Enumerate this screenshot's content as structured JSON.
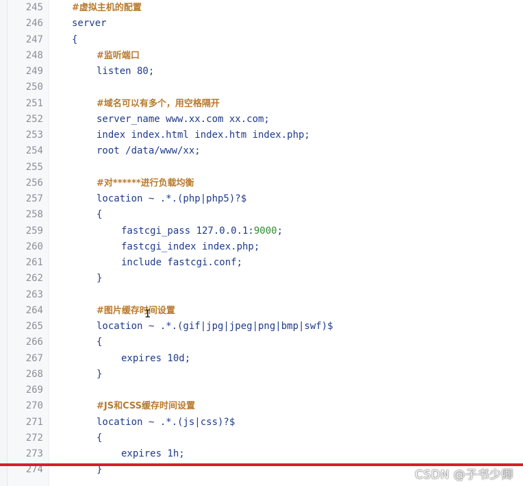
{
  "editor": {
    "lines": [
      {
        "n": "245",
        "text": "#虚拟主机的配置",
        "indent": 0,
        "kind": "comment"
      },
      {
        "n": "246",
        "text": "server",
        "indent": 0,
        "kind": "code"
      },
      {
        "n": "247",
        "text": "{",
        "indent": 0,
        "kind": "code"
      },
      {
        "n": "248",
        "text": "#监听端口",
        "indent": 1,
        "kind": "comment"
      },
      {
        "n": "249",
        "text": "listen 80;",
        "indent": 1,
        "kind": "code"
      },
      {
        "n": "250",
        "text": "",
        "indent": 0,
        "kind": "blank"
      },
      {
        "n": "251",
        "text": "#域名可以有多个，用空格隔开",
        "indent": 1,
        "kind": "comment"
      },
      {
        "n": "252",
        "text": "server_name www.xx.com xx.com;",
        "indent": 1,
        "kind": "code"
      },
      {
        "n": "253",
        "text": "index index.html index.htm index.php;",
        "indent": 1,
        "kind": "code"
      },
      {
        "n": "254",
        "text": "root /data/www/xx;",
        "indent": 1,
        "kind": "code"
      },
      {
        "n": "255",
        "text": "",
        "indent": 0,
        "kind": "blank"
      },
      {
        "n": "256",
        "text": "#对******进行负载均衡",
        "indent": 1,
        "kind": "comment"
      },
      {
        "n": "257",
        "text": "location ~ .*.(php|php5)?$",
        "indent": 1,
        "kind": "code"
      },
      {
        "n": "258",
        "text": "{",
        "indent": 1,
        "kind": "code"
      },
      {
        "n": "259",
        "text": "fastcgi_pass 127.0.0.1:",
        "suffix": "9000",
        "suffix_end": ";",
        "indent": 2,
        "kind": "code-port"
      },
      {
        "n": "260",
        "text": "fastcgi_index index.php;",
        "indent": 2,
        "kind": "code"
      },
      {
        "n": "261",
        "text": "include fastcgi.conf;",
        "indent": 2,
        "kind": "code"
      },
      {
        "n": "262",
        "text": "}",
        "indent": 1,
        "kind": "code"
      },
      {
        "n": "263",
        "text": "",
        "indent": 0,
        "kind": "blank"
      },
      {
        "n": "264",
        "text": "#图片缓存时间设置",
        "indent": 1,
        "kind": "comment"
      },
      {
        "n": "265",
        "text": "location ~ .*.(gif|jpg|jpeg|png|bmp|swf)$",
        "indent": 1,
        "kind": "code"
      },
      {
        "n": "266",
        "text": "{",
        "indent": 1,
        "kind": "code"
      },
      {
        "n": "267",
        "text": "expires 10d;",
        "indent": 2,
        "kind": "code"
      },
      {
        "n": "268",
        "text": "}",
        "indent": 1,
        "kind": "code"
      },
      {
        "n": "269",
        "text": "",
        "indent": 0,
        "kind": "blank"
      },
      {
        "n": "270",
        "text": "#JS和CSS缓存时间设置",
        "indent": 1,
        "kind": "comment"
      },
      {
        "n": "271",
        "text": "location ~ .*.(js|css)?$",
        "indent": 1,
        "kind": "code"
      },
      {
        "n": "272",
        "text": "{",
        "indent": 1,
        "kind": "code"
      },
      {
        "n": "273",
        "text": "expires 1h;",
        "indent": 2,
        "kind": "code"
      },
      {
        "n": "274",
        "text": "}",
        "indent": 1,
        "kind": "code"
      }
    ]
  },
  "colors": {
    "code": "#1e3a8a",
    "comment": "#b8792d",
    "number": "#2e8b2e",
    "line_number": "#8a8f98",
    "accent_bar": "#d81e2b"
  },
  "watermark": {
    "text": "CSDN @子书少卿"
  }
}
